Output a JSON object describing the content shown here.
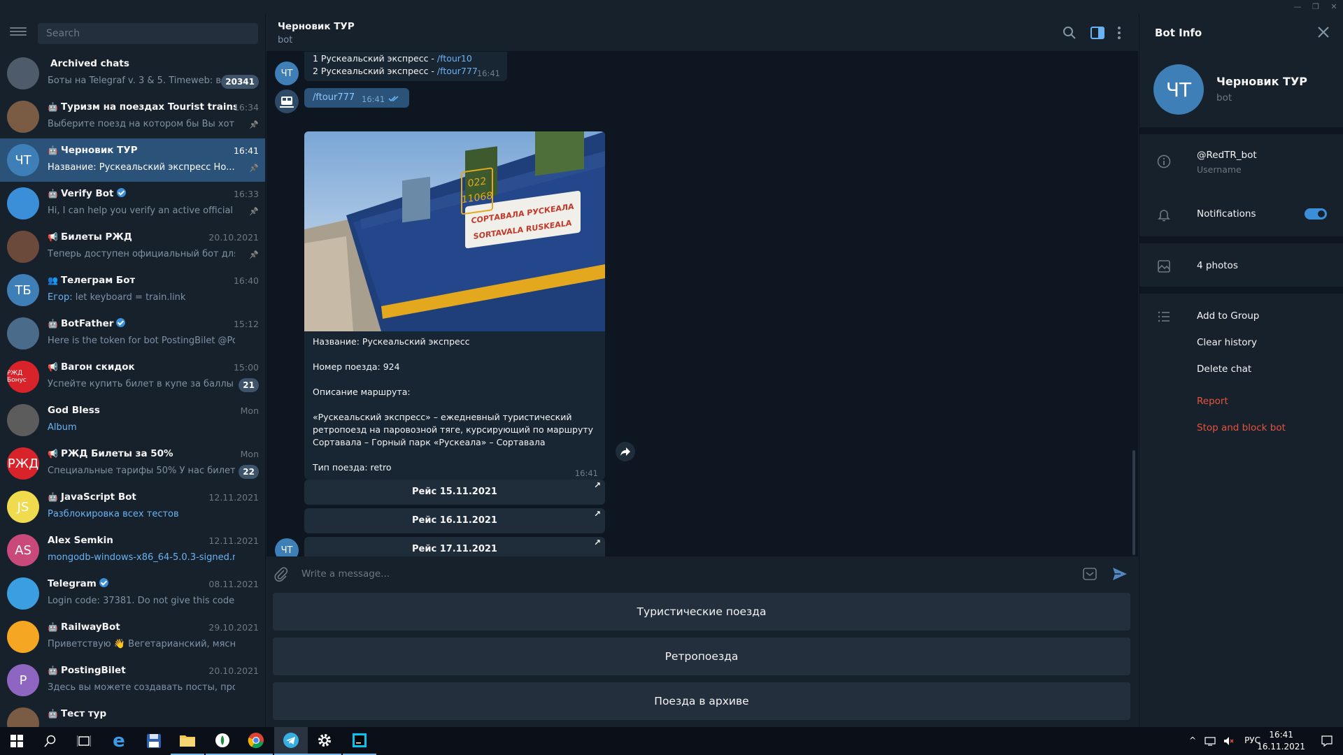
{
  "app": {
    "window_title": ""
  },
  "sidebar": {
    "search_placeholder": "Search",
    "chats": [
      {
        "name": "Archived chats",
        "icon": "archive-icon",
        "msg": "Боты на Telegraf v. 3 & 5. Timeweb: во...",
        "time": "",
        "badge": "20341",
        "avatar_color": "#4d5b6a",
        "avatar_text": "",
        "msg_blue": false
      },
      {
        "name": "Туризм на поездах Tourist trains Ru...",
        "icon": "bot-icon",
        "msg": "Выберите поезд на котором бы Вы хотели ...",
        "time": "16:34",
        "pinned": true,
        "avatar_color": "#7a5b43",
        "avatar_text": ""
      },
      {
        "name": "Черновик ТУР",
        "icon": "bot-icon",
        "msg": "Название:   Рускеальский экспресс  Но...",
        "time": "16:41",
        "pinned": true,
        "avatar_color": "#3e7fb8",
        "avatar_text": "ЧТ",
        "active": true
      },
      {
        "name": "Verify Bot",
        "icon": "bot-icon",
        "verified": true,
        "msg": "Hi, I can help you verify an active official chan...",
        "time": "16:33",
        "pinned": true,
        "avatar_color": "#3a8fd8",
        "avatar_text": ""
      },
      {
        "name": "Билеты РЖД",
        "icon": "channel-icon",
        "msg": "Теперь доступен официальный бот для по...",
        "time": "20.10.2021",
        "pinned": true,
        "avatar_color": "#6b4a3b",
        "avatar_text": ""
      },
      {
        "name": "Телеграм Бот",
        "icon": "group-icon",
        "msg_prefix": "Егор:",
        "msg": " let keyboard = train.link",
        "time": "16:40",
        "avatar_color": "#3e7fb8",
        "avatar_text": "ТБ"
      },
      {
        "name": "BotFather",
        "icon": "bot-icon",
        "verified": true,
        "msg": "Here is the token for bot PostingBilet @PostingBi...",
        "time": "15:12",
        "avatar_color": "#4b6b8a",
        "avatar_text": ""
      },
      {
        "name": "Вагон скидок",
        "icon": "channel-icon",
        "msg": "Успейте купить билет в купе за баллы ...",
        "time": "15:00",
        "badge": "21",
        "avatar_color": "#d8232a",
        "avatar_text": "РЖД Бонус"
      },
      {
        "name": "God Bless",
        "icon": "",
        "msg": "Album",
        "msg_blue": true,
        "time": "Mon",
        "avatar_color": "#5c5c5c",
        "avatar_text": ""
      },
      {
        "name": "РЖД Билеты за 50%",
        "icon": "channel-icon",
        "msg": "Специальные тарифы 50% У нас билет ...",
        "time": "Mon",
        "badge": "22",
        "avatar_color": "#d8232a",
        "avatar_text": "РЖД"
      },
      {
        "name": "JavaScript Bot",
        "icon": "bot-icon",
        "msg": "Разблокировка всех тестов",
        "msg_blue": true,
        "time": "12.11.2021",
        "avatar_color": "#f0db4f",
        "avatar_text": "JS"
      },
      {
        "name": "Alex Semkin",
        "icon": "",
        "msg": "mongodb-windows-x86_64-5.0.3-signed.msi",
        "msg_blue": true,
        "time": "12.11.2021",
        "avatar_color": "#c94a7a",
        "avatar_text": "AS"
      },
      {
        "name": "Telegram",
        "icon": "",
        "verified": true,
        "msg": "Login code: 37381. Do not give this code to anyo...",
        "time": "08.11.2021",
        "avatar_color": "#3a9ee0",
        "avatar_text": ""
      },
      {
        "name": "RailwayBot",
        "icon": "bot-icon",
        "msg": "Приветствую 👋 Вегетарианский, мясной или...",
        "time": "29.10.2021",
        "avatar_color": "#f5a623",
        "avatar_text": ""
      },
      {
        "name": "PostingBilet",
        "icon": "bot-icon",
        "msg": "Здесь вы можете создавать посты, просматри...",
        "time": "20.10.2021",
        "avatar_color": "#8e65c0",
        "avatar_text": "P"
      },
      {
        "name": "Тест тур",
        "icon": "bot-icon",
        "msg": "",
        "time": "",
        "avatar_color": "#7a5b43",
        "avatar_text": ""
      }
    ]
  },
  "header": {
    "title": "Черновик ТУР",
    "subtitle": "bot"
  },
  "messages": {
    "top_bubble": {
      "line1_prefix": "1 Рускеальский экспресс - ",
      "line1_link": "/ftour10",
      "line2_prefix": "2 Рускеальский экспресс - ",
      "line2_link": "/ftour777",
      "time": "16:41"
    },
    "out_bubble": {
      "text": "/ftour777",
      "time": "16:41"
    },
    "photo_caption": {
      "name_line": "Название:   Рускеальский экспресс",
      "number_line": "Номер поезда: 924",
      "desc_label": "Описание маршрута:",
      "desc_1": " «Рускеальский экспресс» – ежедневный туристический",
      "desc_2": "ретропоезд на паровозной тяге, курсирующий по маршруту",
      "desc_3": "Сортавала – Горный парк «Рускеала» – Сортавала",
      "type_line": "Тип поезда: retro",
      "time": "16:41"
    },
    "photo_sign_1": "СОРТАВАЛА  РУСКЕАЛА",
    "photo_sign_2": "SORTAVALA  RUSKEALA",
    "photo_car_num_1": "022",
    "photo_car_num_2": "11068",
    "inline_buttons": [
      "Рейс 15.11.2021",
      "Рейс 16.11.2021",
      "Рейс 17.11.2021"
    ],
    "avatar_text": "ЧТ"
  },
  "composer": {
    "placeholder": "Write a message..."
  },
  "reply_keyboard": [
    "Туристические поезда",
    "Ретропоезда",
    "Поезда в архиве"
  ],
  "bot_info": {
    "title": "Bot Info",
    "avatar_text": "ЧТ",
    "name": "Черновик ТУР",
    "subtitle": "bot",
    "username": "@RedTR_bot",
    "username_label": "Username",
    "notifications_label": "Notifications",
    "notifications_on": true,
    "photos_label": "4 photos",
    "add_to_group": "Add to Group",
    "clear_history": "Clear history",
    "delete_chat": "Delete chat",
    "report": "Report",
    "stop_block": "Stop and block bot"
  },
  "taskbar": {
    "lang": "РУС",
    "time": "16:41",
    "date": "16.11.2021"
  },
  "colors": {
    "accent": "#2b5278",
    "link": "#6ab3f3",
    "danger": "#e5533d",
    "bg": "#0e1621",
    "panel": "#17212b"
  }
}
